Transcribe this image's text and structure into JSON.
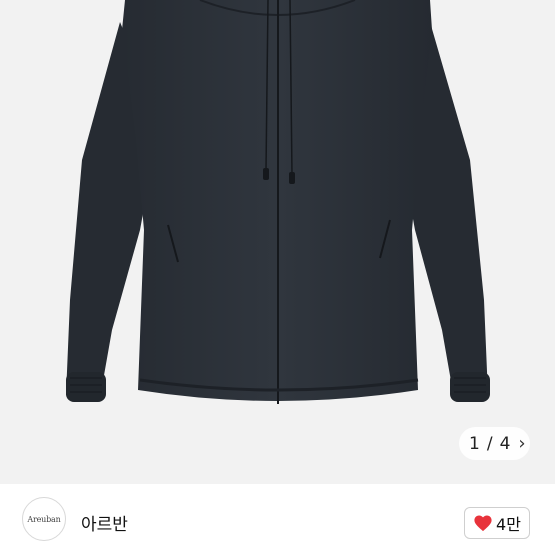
{
  "gallery": {
    "image_description_icon": "jacket-photo",
    "current_page": "1",
    "separator": "/",
    "total_pages": "4",
    "next_icon": "chevron-right-icon"
  },
  "seller": {
    "avatar_text": "Areuban",
    "name": "아르반"
  },
  "like": {
    "icon": "heart-icon",
    "count": "4만",
    "heart_color": "#e8333b"
  },
  "colors": {
    "jacket": "#2a2f36",
    "background": "#f2f2f2"
  }
}
